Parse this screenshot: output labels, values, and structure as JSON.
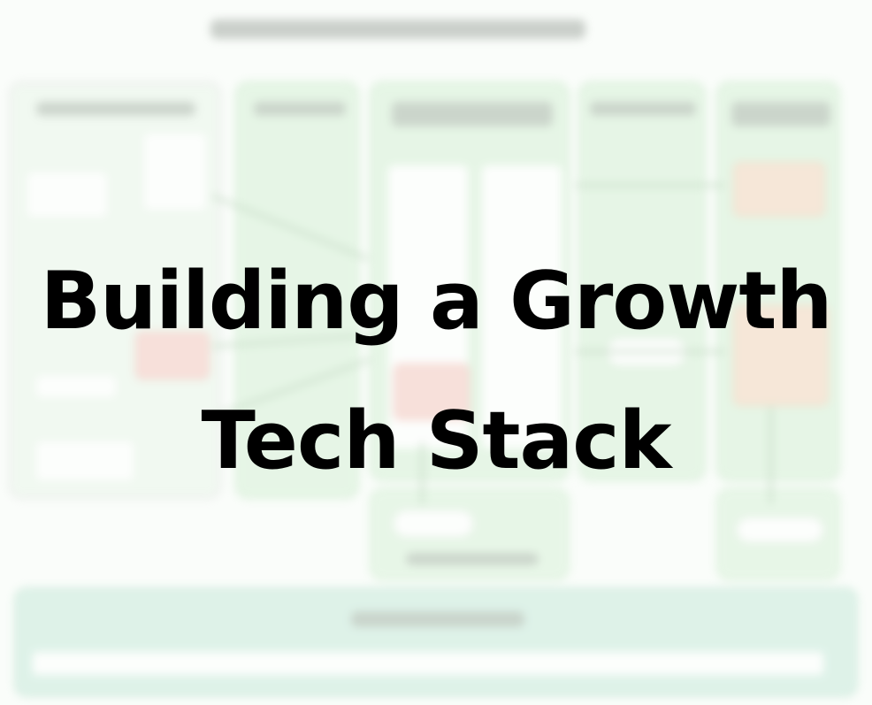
{
  "title": {
    "line1": "Building a Growth",
    "line2": "Tech Stack"
  },
  "colors": {
    "text": "#000000",
    "panel_green": "#d6f0d6",
    "panel_border": "#c2e4c2",
    "accent_red": "#f6c9c1",
    "accent_orange": "#f3d6bd",
    "bottom_bar": "#c8eadb"
  }
}
